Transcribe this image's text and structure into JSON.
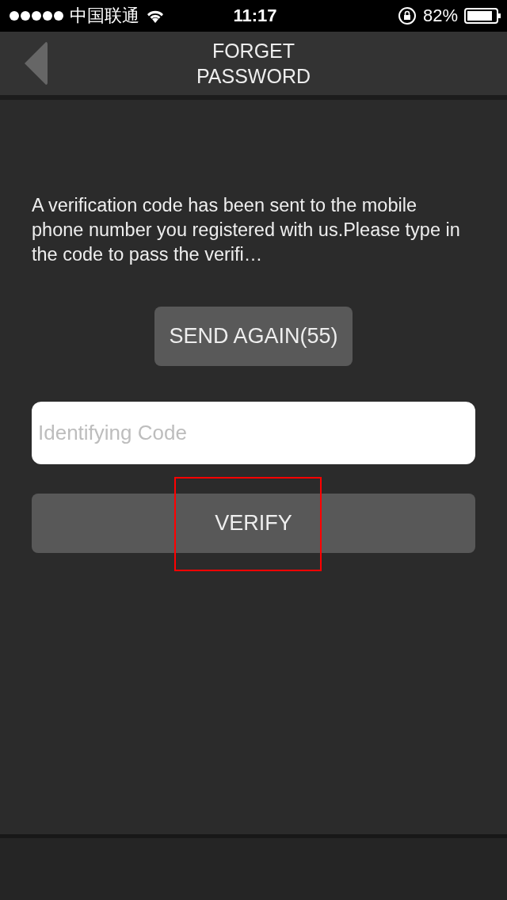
{
  "status_bar": {
    "carrier": "中国联通",
    "time": "11:17",
    "battery": "82%"
  },
  "nav_bar": {
    "title": "FORGET\nPASSWORD"
  },
  "message": "A verification code has been sent to the mobile phone number you registered with us.Please type in the code to pass the verifi…",
  "send_again_button": {
    "label": "SEND AGAIN(55)"
  },
  "code_field": {
    "placeholder": "Identifying Code"
  },
  "verify_button": {
    "label": "VERIFY",
    "highlighted": true
  }
}
